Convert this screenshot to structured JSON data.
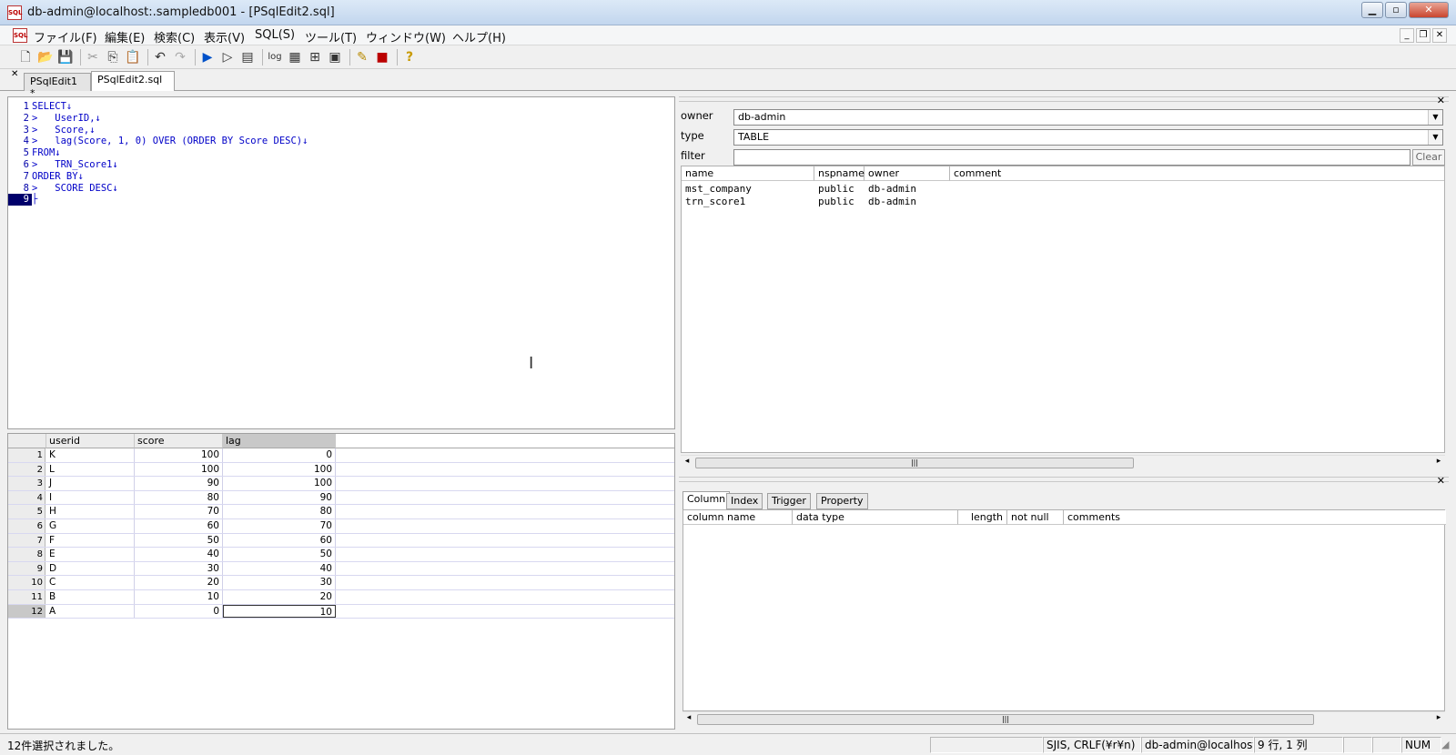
{
  "window": {
    "title": "db-admin@localhost:.sampledb001 - [PSqlEdit2.sql]",
    "icon_label": "SQL"
  },
  "menu": [
    "ファイル(F)",
    "編集(E)",
    "検索(C)",
    "表示(V)",
    "SQL(S)",
    "ツール(T)",
    "ウィンドウ(W)",
    "ヘルプ(H)"
  ],
  "toolbar": {
    "log_label": "log"
  },
  "tabs": [
    {
      "label": "PSqlEdit1 *"
    },
    {
      "label": "PSqlEdit2.sql"
    }
  ],
  "editor": {
    "lines": [
      {
        "n": "1",
        "text": "SELECT↓"
      },
      {
        "n": "2",
        "text": ">   UserID,↓"
      },
      {
        "n": "3",
        "text": ">   Score,↓"
      },
      {
        "n": "4",
        "text": ">   lag(Score, 1, 0) OVER (ORDER BY Score DESC)↓"
      },
      {
        "n": "5",
        "text": "FROM↓"
      },
      {
        "n": "6",
        "text": ">   TRN_Score1↓"
      },
      {
        "n": "7",
        "text": "ORDER BY↓"
      },
      {
        "n": "8",
        "text": ">   SCORE DESC↓"
      },
      {
        "n": "9",
        "text": "├"
      }
    ]
  },
  "grid": {
    "columns": [
      "userid",
      "score",
      "lag"
    ],
    "rows": [
      [
        "1",
        "K",
        "100",
        "0"
      ],
      [
        "2",
        "L",
        "100",
        "100"
      ],
      [
        "3",
        "J",
        "90",
        "100"
      ],
      [
        "4",
        "I",
        "80",
        "90"
      ],
      [
        "5",
        "H",
        "70",
        "80"
      ],
      [
        "6",
        "G",
        "60",
        "70"
      ],
      [
        "7",
        "F",
        "50",
        "60"
      ],
      [
        "8",
        "E",
        "40",
        "50"
      ],
      [
        "9",
        "D",
        "30",
        "40"
      ],
      [
        "10",
        "C",
        "20",
        "30"
      ],
      [
        "11",
        "B",
        "10",
        "20"
      ],
      [
        "12",
        "A",
        "0",
        "10"
      ]
    ]
  },
  "objects": {
    "owner_label": "owner",
    "owner_value": "db-admin",
    "type_label": "type",
    "type_value": "TABLE",
    "filter_label": "filter",
    "filter_value": "",
    "clear_label": "Clear",
    "columns": [
      "name",
      "nspname",
      "owner",
      "comment"
    ],
    "rows": [
      [
        "mst_company",
        "public",
        "db-admin",
        ""
      ],
      [
        "trn_score1",
        "public",
        "db-admin",
        ""
      ]
    ]
  },
  "details": {
    "tabs": [
      "Column",
      "Index",
      "Trigger",
      "Property"
    ],
    "columns": [
      "column name",
      "data type",
      "length",
      "not null",
      "comments"
    ]
  },
  "status": {
    "message": "12件選択されました。",
    "encoding": "SJIS, CRLF(¥r¥n)",
    "connection": "db-admin@localhost:",
    "position": "9 行, 1 列",
    "num": "NUM"
  }
}
